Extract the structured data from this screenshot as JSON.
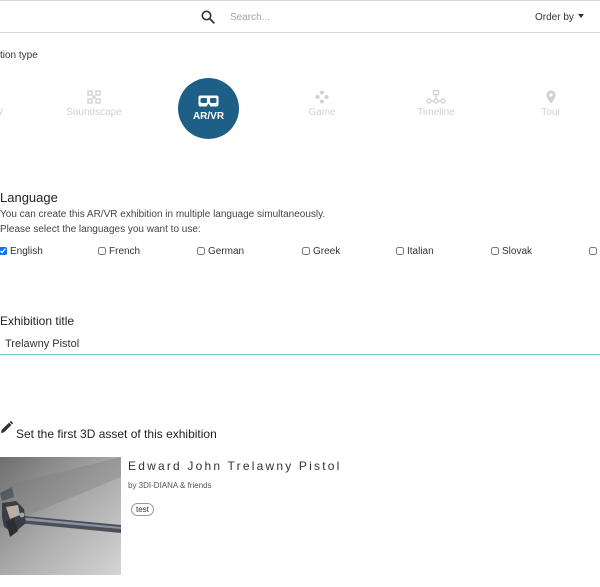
{
  "header": {
    "search_placeholder": "Search...",
    "order_label": "Order by"
  },
  "type_section": {
    "label": "tion type",
    "items": [
      {
        "label": "y",
        "icon": "unknown-icon"
      },
      {
        "label": "Soundscape",
        "icon": "soundscape-icon"
      },
      {
        "label": "AR/VR",
        "icon": "vr-headset-icon",
        "active": true
      },
      {
        "label": "Game",
        "icon": "gamepad-icon"
      },
      {
        "label": "Timeline",
        "icon": "timeline-icon"
      },
      {
        "label": "Tour",
        "icon": "map-pin-icon"
      }
    ],
    "active_color": "#1e5f88"
  },
  "language": {
    "heading": "Language",
    "help_line1": "You can create this AR/VR exhibition in multiple language simultaneously.",
    "help_line2": "Please select the languages you want to use:",
    "options": [
      {
        "label": "English",
        "checked": true
      },
      {
        "label": "French",
        "checked": false
      },
      {
        "label": "German",
        "checked": false
      },
      {
        "label": "Greek",
        "checked": false
      },
      {
        "label": "Italian",
        "checked": false
      },
      {
        "label": "Slovak",
        "checked": false
      }
    ]
  },
  "exhibition": {
    "heading": "Exhibition title",
    "title_value": "Trelawny Pistol"
  },
  "asset": {
    "heading": "Set the first 3D asset of this exhibition",
    "name": "Edward John Trelawny Pistol",
    "by": "by 3DI-DIANA & friends",
    "tag": "test"
  }
}
